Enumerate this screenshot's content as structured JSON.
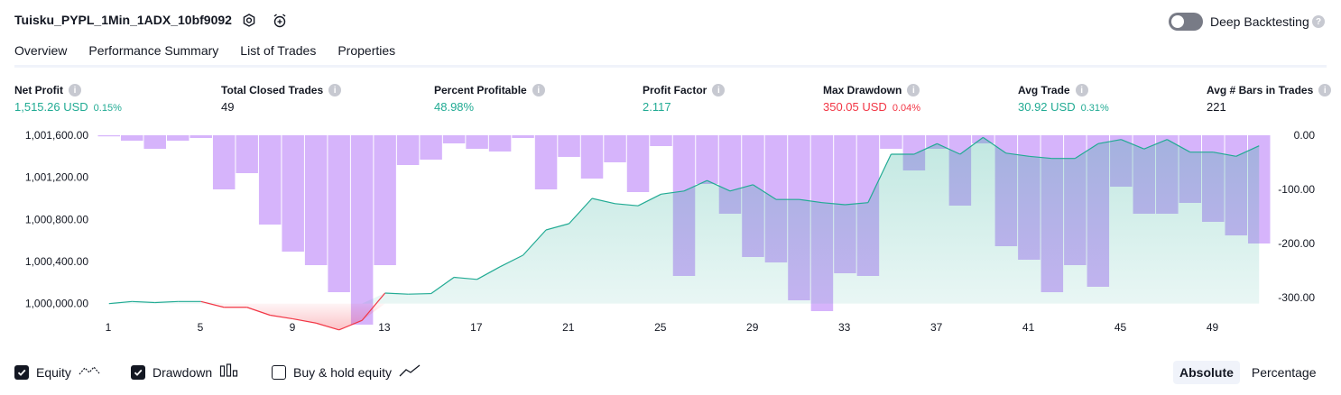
{
  "header": {
    "strategy_name": "Tuisku_PYPL_1Min_1ADX_10bf9092",
    "deep_backtesting_label": "Deep Backtesting",
    "deep_backtesting_enabled": false,
    "icons": [
      "settings-icon",
      "alarm-add-icon",
      "help-icon"
    ]
  },
  "tabs": [
    {
      "label": "Overview",
      "active": true
    },
    {
      "label": "Performance Summary",
      "active": false
    },
    {
      "label": "List of Trades",
      "active": false
    },
    {
      "label": "Properties",
      "active": false
    }
  ],
  "metrics": [
    {
      "label": "Net Profit",
      "value": "1,515.26 USD",
      "sub": "0.15%",
      "color": "#22ab94"
    },
    {
      "label": "Total Closed Trades",
      "value": "49",
      "sub": "",
      "color": "#131722"
    },
    {
      "label": "Percent Profitable",
      "value": "48.98%",
      "sub": "",
      "color": "#22ab94"
    },
    {
      "label": "Profit Factor",
      "value": "2.117",
      "sub": "",
      "color": "#22ab94"
    },
    {
      "label": "Max Drawdown",
      "value": "350.05 USD",
      "sub": "0.04%",
      "color": "#f23645"
    },
    {
      "label": "Avg Trade",
      "value": "30.92 USD",
      "sub": "0.31%",
      "color": "#22ab94"
    },
    {
      "label": "Avg # Bars in Trades",
      "value": "221",
      "sub": "",
      "color": "#131722"
    }
  ],
  "chart_data": {
    "type": "bar",
    "x": [
      1,
      2,
      3,
      4,
      5,
      6,
      7,
      8,
      9,
      10,
      11,
      12,
      13,
      14,
      15,
      16,
      17,
      18,
      19,
      20,
      21,
      22,
      23,
      24,
      25,
      26,
      27,
      28,
      29,
      30,
      31,
      32,
      33,
      34,
      35,
      36,
      37,
      38,
      39,
      40,
      41,
      42,
      43,
      44,
      45,
      46,
      47,
      48,
      49,
      50
    ],
    "x_ticks": [
      1,
      5,
      9,
      13,
      17,
      21,
      25,
      29,
      33,
      37,
      41,
      45,
      49
    ],
    "left_axis_ticks": [
      "1,001,600.00",
      "1,001,200.00",
      "1,000,800.00",
      "1,000,400.00",
      "1,000,000.00"
    ],
    "left_ylim": [
      999800,
      1001600
    ],
    "right_axis_ticks": [
      "0.00",
      "-100.00",
      "-200.00",
      "-300.00"
    ],
    "right_ylim": [
      -350,
      0
    ],
    "series": [
      {
        "name": "Equity",
        "color": "#22ab94",
        "drawdown_color": "#f23645",
        "values": [
          1000000,
          1000020,
          1000010,
          1000020,
          1000020,
          999965,
          999965,
          999890,
          999855,
          999815,
          999750,
          999840,
          1000100,
          1000090,
          1000095,
          1000250,
          1000230,
          1000350,
          1000460,
          1000700,
          1000760,
          1001000,
          1000950,
          1000930,
          1001040,
          1001070,
          1001170,
          1001070,
          1001130,
          1000990,
          1000990,
          1000960,
          1000940,
          1000960,
          1001420,
          1001420,
          1001520,
          1001420,
          1001580,
          1001430,
          1001400,
          1001380,
          1001380,
          1001520,
          1001560,
          1001470,
          1001560,
          1001440,
          1001440,
          1001400,
          1001500
        ]
      },
      {
        "name": "Drawdown",
        "color": "#c89bfa",
        "values": [
          -2,
          -10,
          -25,
          -10,
          -5,
          -100,
          -70,
          -165,
          -215,
          -240,
          -290,
          -350,
          -240,
          -55,
          -45,
          -15,
          -25,
          -30,
          -5,
          -100,
          -40,
          -80,
          -50,
          -105,
          -20,
          -260,
          -90,
          -145,
          -225,
          -235,
          -305,
          -325,
          -255,
          -260,
          -25,
          -65,
          -25,
          -130,
          -15,
          -205,
          -230,
          -290,
          -240,
          -280,
          -95,
          -145,
          -145,
          -125,
          -160,
          -185,
          -200
        ]
      },
      {
        "name": "Buy & hold equity",
        "values": []
      }
    ]
  },
  "legend": [
    {
      "label": "Equity",
      "checked": true,
      "icon": "equity-line-icon"
    },
    {
      "label": "Drawdown",
      "checked": true,
      "icon": "bars-icon"
    },
    {
      "label": "Buy & hold equity",
      "checked": false,
      "icon": "trend-line-icon"
    }
  ],
  "scale_toggle": [
    {
      "label": "Absolute",
      "active": true
    },
    {
      "label": "Percentage",
      "active": false
    }
  ]
}
